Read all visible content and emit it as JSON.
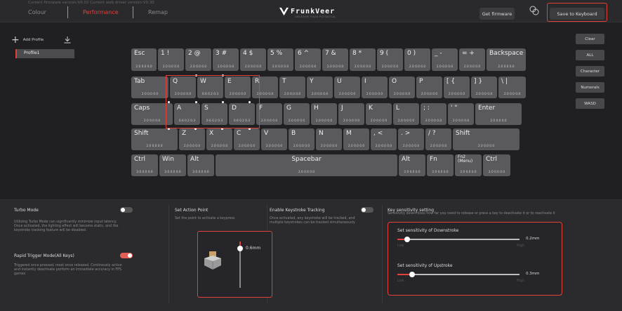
{
  "header": {
    "firmware_line": "Current firmware version:V0.02   Current web driver version:V0.30",
    "tabs": [
      {
        "label": "Colour"
      },
      {
        "label": "Performance"
      },
      {
        "label": "Remap"
      }
    ],
    "logo_text": "FrunkVeer",
    "logo_sub": "UNLEASH YOUR POTENTIAL",
    "get_firmware": "Get firmware",
    "save_to_keyboard": "Save to Keyboard"
  },
  "profiles": {
    "add_label": "Add Profile",
    "items": [
      {
        "label": "Profile1"
      }
    ]
  },
  "presets": {
    "buttons": [
      {
        "label": "Clear"
      },
      {
        "label": "ALL"
      },
      {
        "label": "Character"
      },
      {
        "label": "Numerals"
      },
      {
        "label": "WASD"
      }
    ]
  },
  "keyboard": {
    "rows": [
      [
        {
          "label": "Esc",
          "value": "2.0  0.0  0.0"
        },
        {
          "label": "1 !",
          "value": "2.0  0.0  0.0"
        },
        {
          "label": "2 @",
          "value": "2.0  0.0  0.0"
        },
        {
          "label": "3 #",
          "value": "2.0  0.0  0.0"
        },
        {
          "label": "4 $",
          "value": "2.0  0.0  0.0"
        },
        {
          "label": "5 %",
          "value": "2.0  0.0  0.0"
        },
        {
          "label": "6 ^",
          "value": "2.0  0.0  0.0"
        },
        {
          "label": "7 &",
          "value": "2.0  0.0  0.0"
        },
        {
          "label": "8 *",
          "value": "2.0  0.0  0.0"
        },
        {
          "label": "9 (",
          "value": "2.0  0.0  0.0"
        },
        {
          "label": "0 )",
          "value": "2.0  0.0  0.0"
        },
        {
          "label": "_ -",
          "value": "2.0  0.0  0.0"
        },
        {
          "label": "= +",
          "value": "2.0  0.0  0.0"
        },
        {
          "label": "Backspace",
          "value": "2.0  0.0  0.0"
        }
      ],
      [
        {
          "label": "Tab",
          "value": "2.0  0.0  0.0"
        },
        {
          "label": "Q",
          "value": "2.0  0.0  0.0"
        },
        {
          "label": "W",
          "value": "0.6  0.2  0.3"
        },
        {
          "label": "E",
          "value": "2.0  0.0  0.0"
        },
        {
          "label": "R",
          "value": "2.0  0.0  0.0"
        },
        {
          "label": "T",
          "value": "2.0  0.0  0.0"
        },
        {
          "label": "Y",
          "value": "2.0  0.0  0.0"
        },
        {
          "label": "U",
          "value": "2.0  0.0  0.0"
        },
        {
          "label": "I",
          "value": "2.0  0.0  0.0"
        },
        {
          "label": "O",
          "value": "2.0  0.0  0.0"
        },
        {
          "label": "P",
          "value": "2.0  0.0  0.0"
        },
        {
          "label": "[ {",
          "value": "2.0  0.0  0.0"
        },
        {
          "label": "] }",
          "value": "2.0  0.0  0.0"
        },
        {
          "label": "\\ |",
          "value": "2.0  0.0  0.0"
        }
      ],
      [
        {
          "label": "Caps",
          "value": "2.0  0.0  0.0"
        },
        {
          "label": "A",
          "value": "0.6  0.2  0.3"
        },
        {
          "label": "S",
          "value": "0.6  0.2  0.3"
        },
        {
          "label": "D",
          "value": "0.6  0.2  0.3"
        },
        {
          "label": "F",
          "value": "2.0  0.0  0.0"
        },
        {
          "label": "G",
          "value": "2.0  0.0  0.0"
        },
        {
          "label": "H",
          "value": "2.0  0.0  0.0"
        },
        {
          "label": "J",
          "value": "2.0  0.0  0.0"
        },
        {
          "label": "K",
          "value": "2.0  0.0  0.0"
        },
        {
          "label": "L",
          "value": "2.0  0.0  0.0"
        },
        {
          "label": "; :",
          "value": "2.0  0.0  0.0"
        },
        {
          "label": "' \"",
          "value": "2.0  0.0  0.0"
        },
        {
          "label": "Enter",
          "value": "2.0  0.0  0.0"
        }
      ],
      [
        {
          "label": "Shift",
          "value": "2.0  0.0  0.0"
        },
        {
          "label": "Z",
          "value": "2.0  0.0  0.0"
        },
        {
          "label": "X",
          "value": "2.0  0.0  0.0"
        },
        {
          "label": "C",
          "value": "2.0  0.0  0.0"
        },
        {
          "label": "V",
          "value": "2.0  0.0  0.0"
        },
        {
          "label": "B",
          "value": "2.0  0.0  0.0"
        },
        {
          "label": "N",
          "value": "2.0  0.0  0.0"
        },
        {
          "label": "M",
          "value": "2.0  0.0  0.0"
        },
        {
          "label": ", <",
          "value": "2.0  0.0  0.0"
        },
        {
          "label": ". >",
          "value": "2.0  0.0  0.0"
        },
        {
          "label": "/ ?",
          "value": "2.0  0.0  0.0"
        },
        {
          "label": "Shift",
          "value": "2.0  0.0  0.0"
        }
      ],
      [
        {
          "label": "Ctrl",
          "value": "2.0  0.0  0.0"
        },
        {
          "label": "Win",
          "value": "2.0  0.0  0.0"
        },
        {
          "label": "Alt",
          "value": "2.0  0.0  0.0"
        },
        {
          "label": "Spacebar",
          "value": "2.0  0.0  0.0"
        },
        {
          "label": "Alt",
          "value": "2.0  0.0  0.0"
        },
        {
          "label": "Fn",
          "value": "2.0  0.0  0.0"
        },
        {
          "label": "Fn2\n(Menu)",
          "value": "2.0  0.0  0.0"
        },
        {
          "label": "Ctrl",
          "value": "2.0  0.0  0.0"
        }
      ]
    ]
  },
  "turbo": {
    "title": "Turbo Mode",
    "desc": "Utilizing Turbo Mode can significantly minimize input latency. Once activated, the lighting effect will become static, and the keystroke tracking feature will be disabled.",
    "enabled": false
  },
  "rapid": {
    "title": "Rapid Trigger Mode(All Keys)",
    "desc": "Triggered once pressed, reset once released. Continously active and instantly deactivate perform an immediate accuracy in FPS games",
    "enabled": true
  },
  "action_point": {
    "title": "Set Action Point",
    "desc": "Set the point to activate a keypress",
    "value_label": "0.6mm",
    "fraction": 0.15
  },
  "tracking": {
    "title": "Enable Keystroke Tracking",
    "desc": "Once activated, any keystroke will be tracked, and multiple keystrokes can be tracked simultaneously",
    "enabled": false
  },
  "sensitivity": {
    "title": "Key sensitivity setting",
    "desc": "Sensitivity determines how far you need to release or press a key to deactivate it or to reactivate it",
    "downstroke": {
      "title": "Set sensitivity of Downstroke",
      "value_label": "0.2mm",
      "low": "Low",
      "high": "High",
      "fraction": 0.08
    },
    "upstroke": {
      "title": "Set sensitivity of Upstroke",
      "value_label": "0.3mm",
      "low": "Low",
      "high": "High",
      "fraction": 0.12
    }
  },
  "colors": {
    "accent": "#e2403a",
    "key": "#5a5a5e",
    "background": "#202023"
  }
}
